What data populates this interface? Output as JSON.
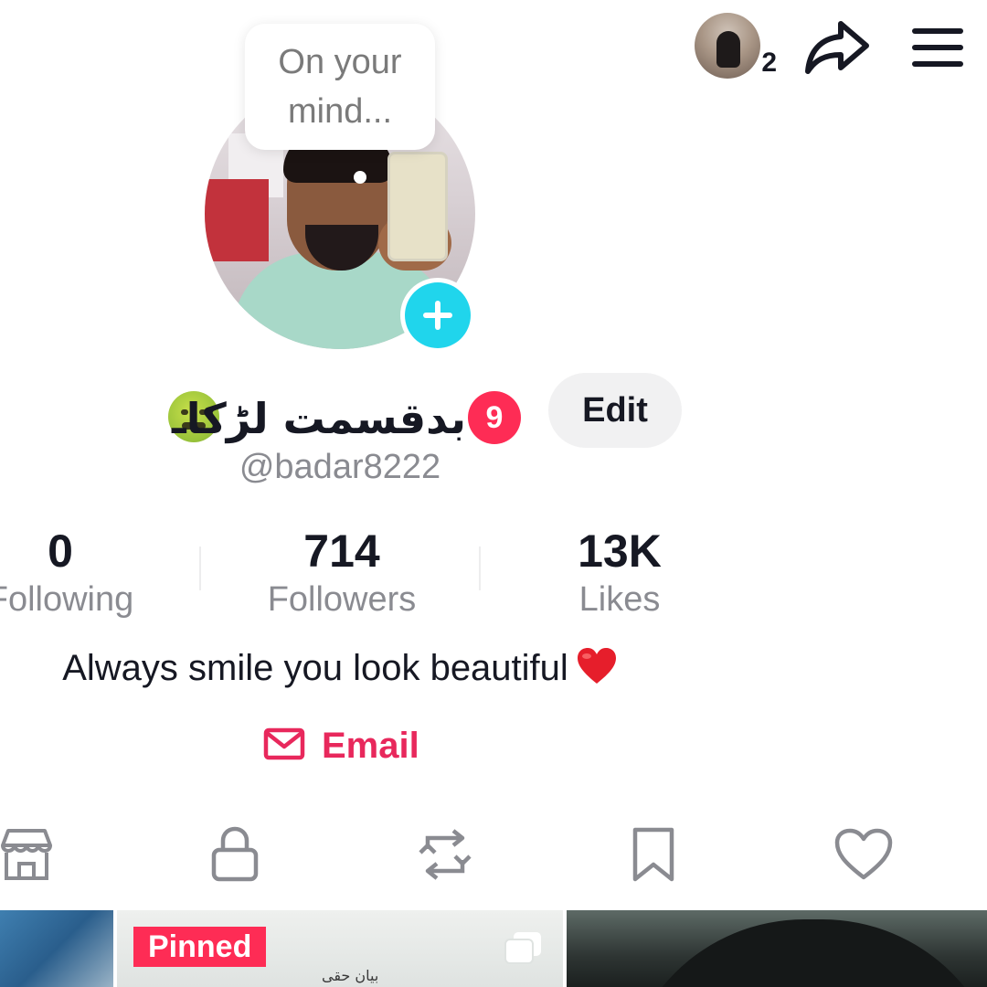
{
  "header": {
    "viewer_count": "2",
    "icons": [
      "viewer-avatar",
      "share-icon",
      "menu-icon"
    ]
  },
  "profile": {
    "bubble_text": "On your mind...",
    "display_name": "بدقسمت لڑکاـ",
    "name_emoji": "nauseated-face-emoji",
    "notification_count": "9",
    "edit_label": "Edit",
    "handle": "@badar8222"
  },
  "stats": {
    "following": {
      "value": "0",
      "label": "Following"
    },
    "followers": {
      "value": "714",
      "label": "Followers"
    },
    "likes": {
      "value": "13K",
      "label": "Likes"
    }
  },
  "bio": {
    "text": "Always smile you look beautiful",
    "emoji": "red-heart-emoji"
  },
  "email": {
    "label": "Email"
  },
  "tabs": [
    "shop-icon",
    "lock-icon",
    "repost-icon",
    "bookmark-icon",
    "heart-icon"
  ],
  "grid": {
    "pinned_label": "Pinned",
    "caption": "بیان حقی"
  },
  "colors": {
    "accent": "#fe2c55",
    "email": "#e8285c",
    "add_button": "#20d5ec",
    "secondary_text": "#8a8b91"
  }
}
